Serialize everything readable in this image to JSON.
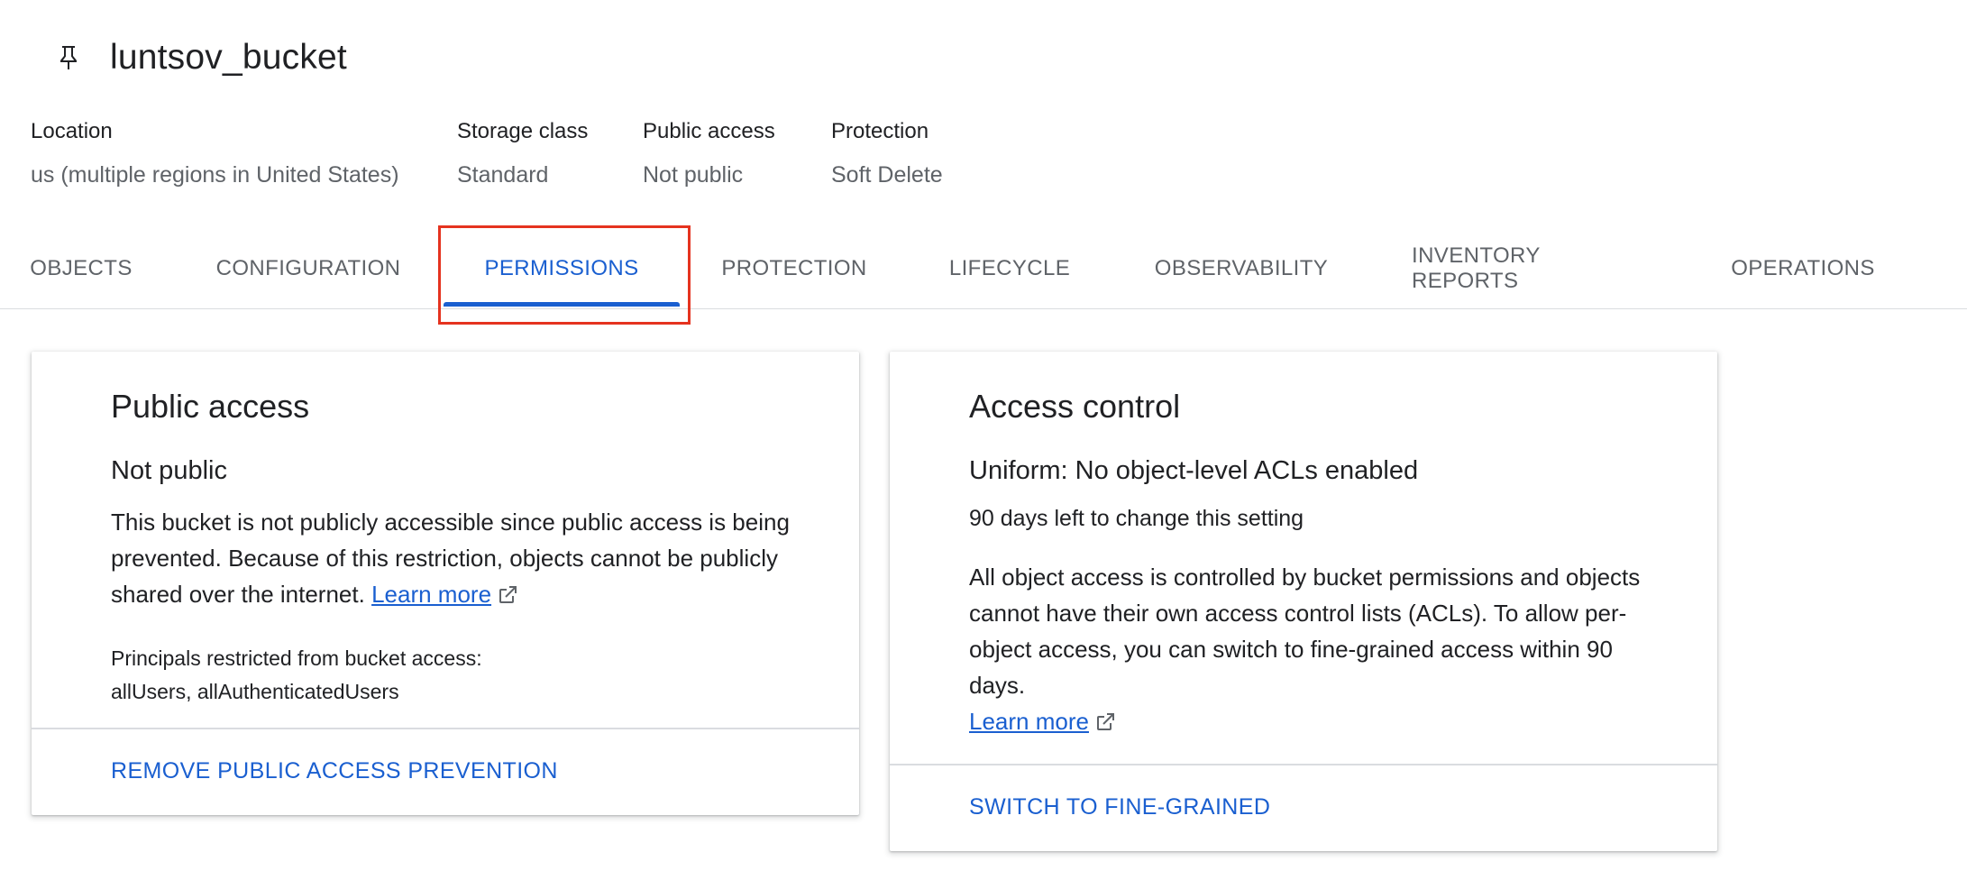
{
  "bucket": {
    "name": "luntsov_bucket"
  },
  "meta": [
    {
      "label": "Location",
      "value": "us (multiple regions in United States)"
    },
    {
      "label": "Storage class",
      "value": "Standard"
    },
    {
      "label": "Public access",
      "value": "Not public"
    },
    {
      "label": "Protection",
      "value": "Soft Delete"
    }
  ],
  "tabs": [
    {
      "label": "OBJECTS"
    },
    {
      "label": "CONFIGURATION"
    },
    {
      "label": "PERMISSIONS"
    },
    {
      "label": "PROTECTION"
    },
    {
      "label": "LIFECYCLE"
    },
    {
      "label": "OBSERVABILITY"
    },
    {
      "label": "INVENTORY REPORTS"
    },
    {
      "label": "OPERATIONS"
    }
  ],
  "active_tab": "PERMISSIONS",
  "public_access_card": {
    "title": "Public access",
    "status": "Not public",
    "description": "This bucket is not publicly accessible since public access is being prevented. Because of this restriction, objects cannot be publicly shared over the internet.",
    "learn_more": "Learn more",
    "principals_label": "Principals restricted from bucket access:",
    "principals_value": "allUsers, allAuthenticatedUsers",
    "action": "REMOVE PUBLIC ACCESS PREVENTION"
  },
  "access_control_card": {
    "title": "Access control",
    "status": "Uniform: No object-level ACLs enabled",
    "days_left": "90 days left to change this setting",
    "description": "All object access is controlled by bucket permissions and objects cannot have their own access control lists (ACLs). To allow per-object access, you can switch to fine-grained access within 90 days.",
    "learn_more": "Learn more",
    "action": "SWITCH TO FINE-GRAINED"
  },
  "colors": {
    "accent": "#1a5fd0",
    "highlight": "#e5331f",
    "muted_text": "#5f6368",
    "divider": "#dadce0"
  },
  "icons": {
    "pin": "pin-icon",
    "external_link": "external-link-icon"
  }
}
